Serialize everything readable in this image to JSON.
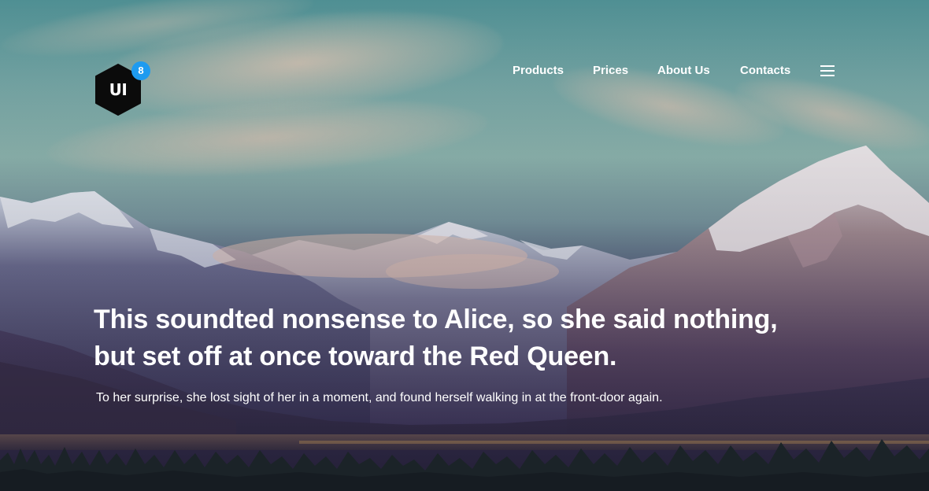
{
  "brand": {
    "logo_text": "UI",
    "badge": "8"
  },
  "nav": {
    "items": [
      {
        "label": "Products"
      },
      {
        "label": "Prices"
      },
      {
        "label": "About Us"
      },
      {
        "label": "Contacts"
      }
    ],
    "menu_icon": "hamburger-menu-icon"
  },
  "hero": {
    "headline_line1": "This soundted nonsense to Alice, so she said nothing,",
    "headline_line2": "but set off at once toward the Red Queen.",
    "subtext": "To her surprise, she lost sight of her in a moment, and found herself walking in at the front-door again."
  },
  "colors": {
    "badge": "#1e9bf0",
    "logo_bg": "#0b0b0b",
    "text": "#ffffff"
  }
}
